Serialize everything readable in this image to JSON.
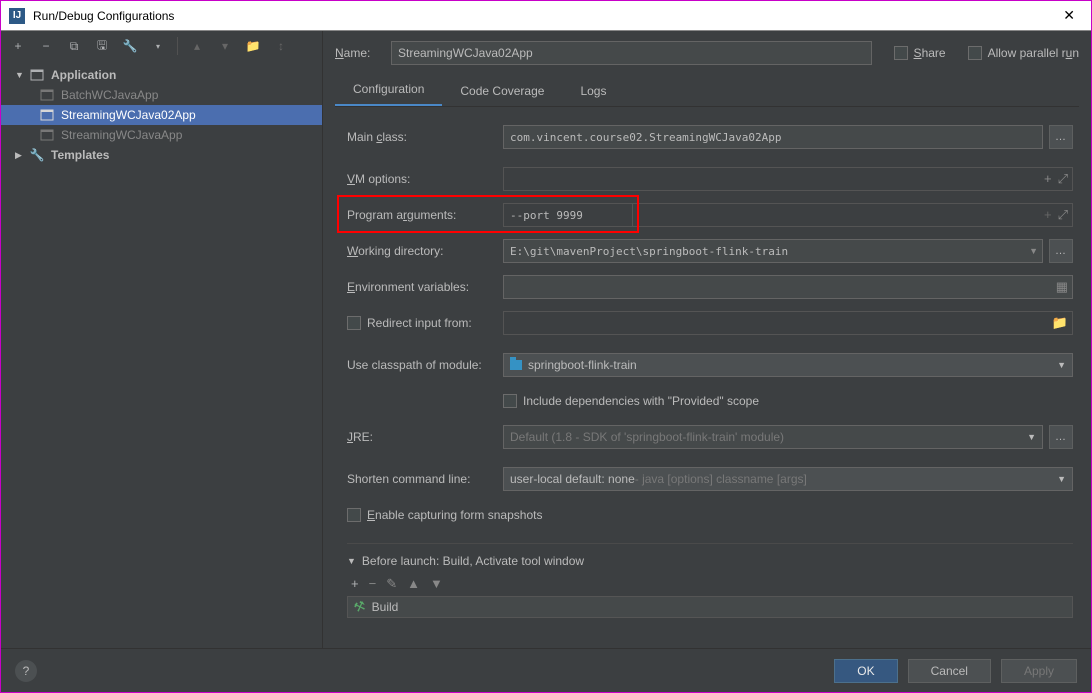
{
  "window": {
    "title": "Run/Debug Configurations"
  },
  "tree": {
    "application": "Application",
    "items": [
      "BatchWCJavaApp",
      "StreamingWCJava02App",
      "StreamingWCJavaApp"
    ],
    "templates": "Templates"
  },
  "nameRow": {
    "label": "Name:",
    "value": "StreamingWCJava02App",
    "share": "Share",
    "parallel": "Allow parallel run"
  },
  "tabs": {
    "config": "Configuration",
    "coverage": "Code Coverage",
    "logs": "Logs"
  },
  "form": {
    "mainClassLabel": "Main class:",
    "mainClassValue": "com.vincent.course02.StreamingWCJava02App",
    "vmLabel": "VM options:",
    "vmValue": "",
    "argsLabel": "Program arguments:",
    "argsValue": "--port 9999",
    "workdirLabel": "Working directory:",
    "workdirValue": "E:\\git\\mavenProject\\springboot-flink-train",
    "envLabel": "Environment variables:",
    "envValue": "",
    "redirectLabel": "Redirect input from:",
    "classpathLabel": "Use classpath of module:",
    "classpathValue": "springboot-flink-train",
    "includeDeps": "Include dependencies with \"Provided\" scope",
    "jreLabel": "JRE:",
    "jreValue": "Default (1.8 - SDK of 'springboot-flink-train' module)",
    "shortenLabel": "Shorten command line:",
    "shortenValue": "user-local default: none",
    "shortenSuffix": " - java [options] classname [args]",
    "enableSnap": "Enable capturing form snapshots",
    "beforeLaunch": "Before launch: Build, Activate tool window",
    "build": "Build"
  },
  "footer": {
    "ok": "OK",
    "cancel": "Cancel",
    "apply": "Apply"
  }
}
